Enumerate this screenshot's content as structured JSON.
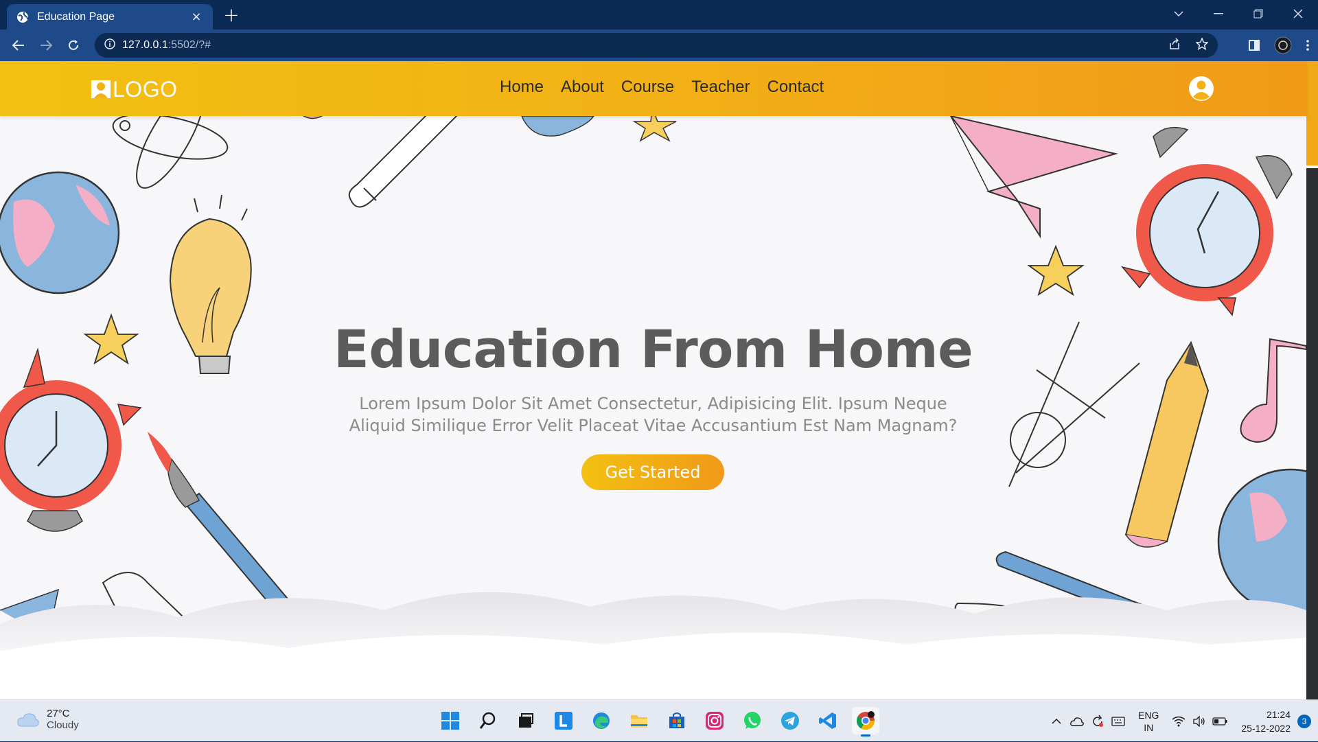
{
  "browser": {
    "tab_title": "Education Page",
    "url_host": "127.0.0.1",
    "url_path": ":5502/?#",
    "new_tab_glyph": "+",
    "close_glyph": "×"
  },
  "site": {
    "logo_text": "LOGO",
    "nav": [
      {
        "label": "Home"
      },
      {
        "label": "About"
      },
      {
        "label": "Course"
      },
      {
        "label": "Teacher"
      },
      {
        "label": "Contact"
      }
    ],
    "hero": {
      "title": "Education From Home",
      "subtitle": "Lorem Ipsum Dolor Sit Amet Consectetur, Adipisicing Elit. Ipsum Neque Aliquid Similique Error Velit Placeat Vitae Accusantium Est Nam Magnam?",
      "cta_label": "Get Started"
    },
    "colors": {
      "header_start": "#f2c012",
      "header_end": "#f09a18",
      "title": "#5c5c5c",
      "subtitle": "#8a8a8a"
    }
  },
  "taskbar": {
    "weather_temp": "27°C",
    "weather_desc": "Cloudy",
    "apps": [
      "start-icon",
      "search-icon",
      "task-view-icon",
      "l-app-icon",
      "edge-icon",
      "file-explorer-icon",
      "store-icon",
      "instagram-icon",
      "whatsapp-icon",
      "telegram-icon",
      "vscode-icon",
      "chrome-icon"
    ],
    "lang_line1": "ENG",
    "lang_line2": "IN",
    "time": "21:24",
    "date": "25-12-2022",
    "notification_count": "3"
  }
}
